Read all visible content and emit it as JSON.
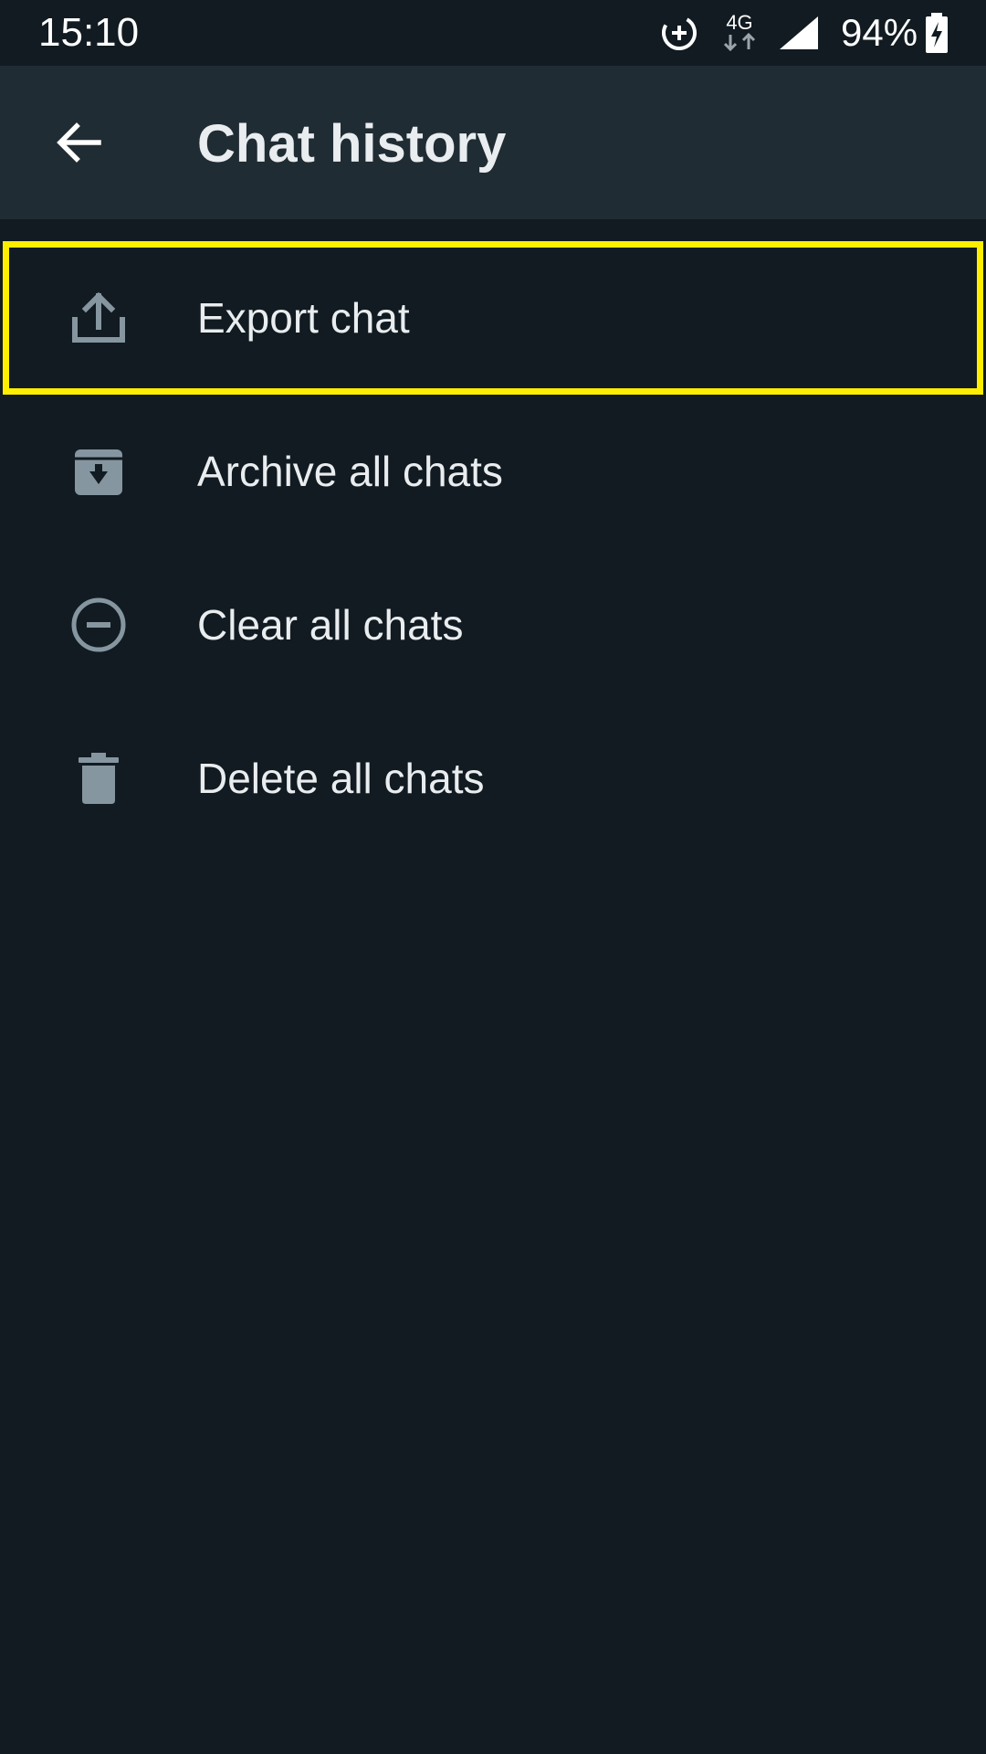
{
  "status_bar": {
    "time": "15:10",
    "network_type": "4G",
    "battery_percent": "94%"
  },
  "app_bar": {
    "title": "Chat history"
  },
  "menu": {
    "items": [
      {
        "label": "Export chat",
        "icon": "export-icon"
      },
      {
        "label": "Archive all chats",
        "icon": "archive-icon"
      },
      {
        "label": "Clear all chats",
        "icon": "clear-icon"
      },
      {
        "label": "Delete all chats",
        "icon": "trash-icon"
      }
    ]
  },
  "colors": {
    "background": "#111b21",
    "app_bar": "#202c33",
    "text": "#e9edef",
    "icon": "#8696a0",
    "highlight": "#ffee00"
  }
}
